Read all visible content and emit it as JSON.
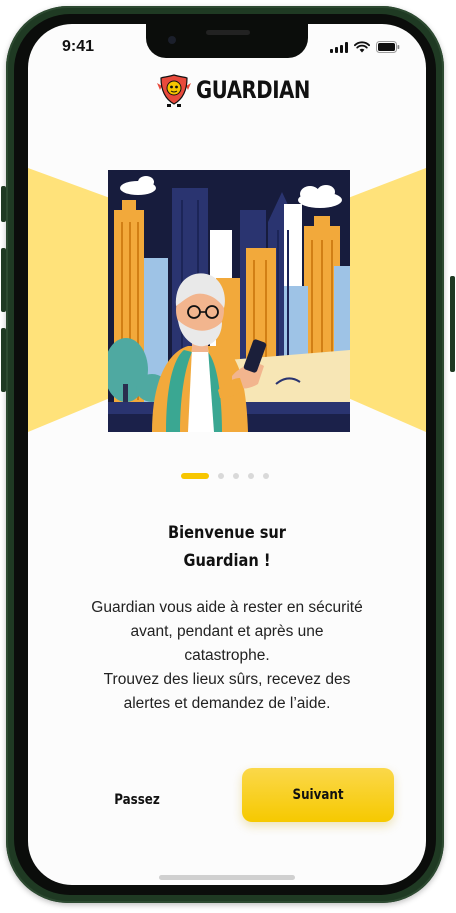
{
  "status_bar": {
    "time": "9:41"
  },
  "header": {
    "brand": "GUARDIAN",
    "logo_icon": "shield-mascot-icon"
  },
  "onboarding": {
    "illustration": "elderly-man-with-phone-city-illustration",
    "page_count": 5,
    "current_page": 1,
    "title": "Bienvenue sur\nGuardian !",
    "body": "Guardian vous aide à rester en sécurité\navant, pendant et après une\ncatastrophe.\nTrouvez des lieux sûrs, recevez des\nalertes et demandez de l’aide."
  },
  "actions": {
    "skip_label": "Passez",
    "next_label": "Suivant"
  },
  "colors": {
    "accent": "#F7C600",
    "beam": "#FFE27A",
    "frame": "#1F3A23",
    "text": "#111111"
  }
}
